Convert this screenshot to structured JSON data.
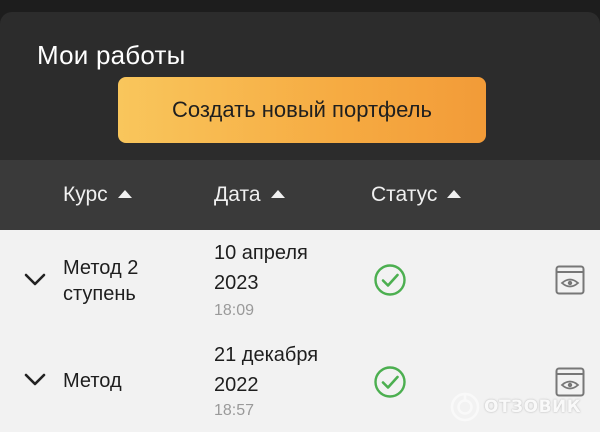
{
  "header": {
    "title": "Мои работы",
    "create_button_label": "Создать новый портфель"
  },
  "table": {
    "columns": [
      {
        "label": "Курс",
        "sort": "ascending"
      },
      {
        "label": "Дата",
        "sort": "ascending"
      },
      {
        "label": "Статус",
        "sort": "ascending"
      }
    ],
    "rows": [
      {
        "course": "Метод 2\nступень",
        "date": "10 апреля\n2023",
        "time": "18:09",
        "status": "completed",
        "status_icon": "check-circle-icon",
        "action_icon": "eye-icon"
      },
      {
        "course": "Метод",
        "date": "21 декабря\n2022",
        "time": "18:57",
        "status": "completed",
        "status_icon": "check-circle-icon",
        "action_icon": "eye-icon"
      }
    ]
  },
  "watermark": {
    "text": "ОТЗОВИК"
  },
  "colors": {
    "accent_button": "#f6ab42",
    "status_ok": "#4caf50",
    "header_bg": "#2c2c2c",
    "table_header_bg": "#3a3a3a",
    "table_body_bg": "#f2f2f2"
  }
}
